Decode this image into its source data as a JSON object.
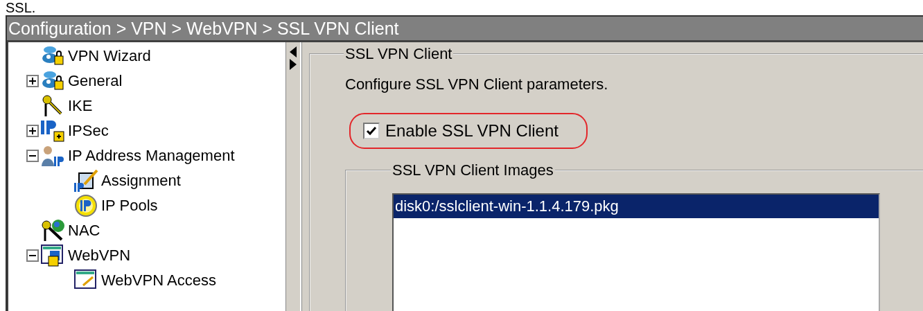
{
  "caption": "SSL.",
  "window": {
    "title": "Configuration > VPN > WebVPN > SSL VPN Client"
  },
  "tree": [
    {
      "label": "VPN Wizard",
      "kind": "lock-network"
    },
    {
      "label": "General",
      "kind": "lock-network",
      "expanded": false
    },
    {
      "label": "IKE",
      "kind": "key"
    },
    {
      "label": "IPSec",
      "kind": "ip-lock",
      "expanded": false
    },
    {
      "label": "IP Address Management",
      "kind": "person-ip",
      "expanded": true,
      "children": [
        {
          "label": "Assignment",
          "kind": "ip-edit"
        },
        {
          "label": "IP Pools",
          "kind": "ip-circle"
        }
      ]
    },
    {
      "label": "NAC",
      "kind": "key-globe"
    },
    {
      "label": "WebVPN",
      "kind": "web-lock",
      "expanded": true,
      "children": [
        {
          "label": "WebVPN Access",
          "kind": "web-page"
        }
      ]
    }
  ],
  "panel": {
    "legend": "SSL VPN Client",
    "description": "Configure SSL VPN Client parameters.",
    "enable": {
      "label": "Enable SSL VPN Client",
      "checked": true,
      "highlighted": true
    },
    "images": {
      "legend": "SSL VPN Client Images",
      "items": [
        {
          "text": "disk0:/sslclient-win-1.1.4.179.pkg",
          "selected": true
        }
      ]
    }
  }
}
